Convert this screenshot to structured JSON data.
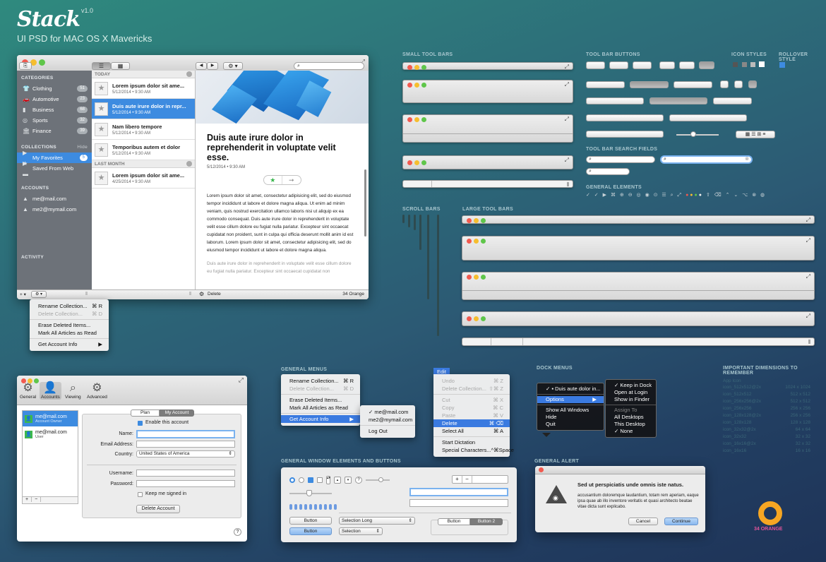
{
  "header": {
    "brand": "Stack",
    "version": "v1.0",
    "subtitle": "UI PSD for MAC OS X Mavericks"
  },
  "main_window": {
    "sidebar": {
      "categories_header": "CATEGORIES",
      "categories": [
        {
          "label": "Clothing",
          "count": "51",
          "icon": "shirt-icon"
        },
        {
          "label": "Automotive",
          "count": "23",
          "icon": "car-icon"
        },
        {
          "label": "Business",
          "count": "68",
          "icon": "chart-icon"
        },
        {
          "label": "Sports",
          "count": "32",
          "icon": "ball-icon"
        },
        {
          "label": "Finance",
          "count": "39",
          "icon": "bank-icon"
        }
      ],
      "collections_header": "COLLECTIONS",
      "collections_hide": "Hide",
      "collections": [
        {
          "label": "My Favorites",
          "count": "5"
        },
        {
          "label": "Saved From Web",
          "count": ""
        }
      ],
      "accounts_header": "ACCOUNTS",
      "accounts": [
        "me@mail.com",
        "me2@mymail.com"
      ],
      "activity_header": "ACTIVITY"
    },
    "list": {
      "today_header": "TODAY",
      "today": [
        {
          "title": "Lorem ipsum dolor sit ame...",
          "date": "5/12/2014  •  9:30 AM",
          "selected": false
        },
        {
          "title": "Duis aute irure dolor in repr...",
          "date": "5/12/2014  •  9:30 AM",
          "selected": true
        },
        {
          "title": "Nam libero tempore",
          "date": "5/12/2014  •  9:30 AM",
          "selected": false
        },
        {
          "title": "Temporibus autem et dolor",
          "date": "5/12/2014  •  9:30 AM",
          "selected": false
        }
      ],
      "last_month_header": "LAST MONTH",
      "last_month": [
        {
          "title": "Lorem ipsum dolor sit ame...",
          "date": "4/25/2014  •  9:30 AM",
          "selected": false
        }
      ]
    },
    "article": {
      "title": "Duis aute irure dolor in reprehenderit in voluptate velit esse.",
      "date": "5/12/2014  •  9:30 AM",
      "body": "Lorem ipsum dolor sit amet, consectetur adipisicing elit, sed do eiusmod tempor incididunt ut labore et dolore magna aliqua. Ut enim ad minim veniam, quis nostrud exercitation ullamco laboris nisi ut aliquip ex ea commodo consequat. Duis aute irure dolor in reprehenderit in voluptate velit esse cillum dolore eu fugiat nulla pariatur. Excepteur sint occaecat cupidatat non proident, sunt in culpa qui officia deserunt mollit anim id est laborum. Lorem ipsum dolor sit amet, consectetur adipisicing elit, sed do eiusmod tempor incididunt ut labore et dolore magna aliqua.",
      "body2": "Duis aute irure dolor in reprehenderit in voluptate velit esse cillum dolore eu fugiat nulla pariatur. Excepteur sint occaecat cupidatat non"
    },
    "bottom_bar": {
      "add": "+ ▾",
      "gear": "⚙ ▾",
      "delete": "Delete",
      "status": "34 Orange"
    }
  },
  "context_menu": [
    {
      "label": "Rename Collection...",
      "shortcut": "⌘ R",
      "disabled": false
    },
    {
      "label": "Delete Collection...",
      "shortcut": "⌘ D",
      "disabled": true
    },
    {
      "sep": true
    },
    {
      "label": "Erase Deleted Items...",
      "shortcut": "",
      "disabled": false
    },
    {
      "label": "Mark All Articles as Read",
      "shortcut": "",
      "disabled": false
    },
    {
      "sep": true
    },
    {
      "label": "Get Account Info",
      "shortcut": "▶",
      "disabled": false
    }
  ],
  "sections": {
    "small_tool_bars": "SMALL TOOL BARS",
    "tool_bar_buttons": "TOOL BAR BUTTONS",
    "icon_styles": "ICON STYLES",
    "rollover_style": "ROLLOVER STYLE",
    "tool_bar_search_fields": "TOOL BAR SEARCH FIELDS",
    "general_elements": "GENERAL ELEMENTS",
    "scroll_bars": "SCROLL BARS",
    "large_tool_bars": "LARGE TOOL BARS",
    "general_menus": "GENERAL MENUS",
    "dock_menus": "DOCK MENUS",
    "important_dimensions": "IMPORTANT DIMENSIONS TO REMEMBER",
    "general_window": "GENERAL WINDOW ELEMENTS AND BUTTONS",
    "general_alert": "GENERAL ALERT"
  },
  "general_menu": [
    {
      "label": "Rename Collection...",
      "shortcut": "⌘ R",
      "disabled": false
    },
    {
      "label": "Delete Collection...",
      "shortcut": "⌘ D",
      "disabled": true
    },
    {
      "sep": true
    },
    {
      "label": "Erase Deleted Items...",
      "shortcut": "",
      "disabled": false
    },
    {
      "label": "Mark All Articles as Read",
      "shortcut": "",
      "disabled": false
    },
    {
      "sep": true
    },
    {
      "label": "Get Account Info",
      "shortcut": "▶",
      "disabled": false,
      "selected": true
    }
  ],
  "submenu": [
    {
      "label": "✓ me@mail.com"
    },
    {
      "label": "me2@mymail.com"
    },
    {
      "sep": true
    },
    {
      "label": "Log Out"
    }
  ],
  "edit_menu": {
    "title": "Edit",
    "items": [
      {
        "label": "Undo",
        "shortcut": "⌘ Z",
        "disabled": true
      },
      {
        "label": "Delete Collection...",
        "shortcut": "⇧⌘ Z",
        "disabled": true
      },
      {
        "sep": true
      },
      {
        "label": "Cut",
        "shortcut": "⌘ X",
        "disabled": true
      },
      {
        "label": "Copy",
        "shortcut": "⌘ C",
        "disabled": true
      },
      {
        "label": "Paste",
        "shortcut": "⌘ V",
        "disabled": true
      },
      {
        "label": "Delete",
        "shortcut": "⌘ ⌫",
        "disabled": false,
        "selected": true
      },
      {
        "label": "Select All",
        "shortcut": "⌘ A",
        "disabled": false
      },
      {
        "sep": true
      },
      {
        "label": "Start Dictation",
        "shortcut": "",
        "disabled": false
      },
      {
        "label": "Special Characters...",
        "shortcut": "^⌘Space",
        "disabled": false
      }
    ]
  },
  "dock_menu": {
    "items": [
      {
        "label": "✓ ▪ Duis aute dolor in...",
        "selected": false
      },
      {
        "sep": true
      },
      {
        "label": "Options",
        "shortcut": "▶",
        "selected": true
      },
      {
        "sep": true
      },
      {
        "label": "Show All Windows",
        "selected": false
      },
      {
        "label": "Hide",
        "selected": false
      },
      {
        "label": "Quit",
        "selected": false
      }
    ],
    "submenu": [
      {
        "label": "✓ Keep in Dock",
        "disabled": false
      },
      {
        "label": "Open at Login",
        "disabled": false
      },
      {
        "label": "Show in Finder",
        "disabled": false
      },
      {
        "sep": true
      },
      {
        "label": "Assign To",
        "disabled": true
      },
      {
        "label": "All Desktops",
        "disabled": false
      },
      {
        "label": "This Desktop",
        "disabled": false
      },
      {
        "label": "✓ None",
        "disabled": false
      }
    ]
  },
  "dimensions": {
    "header": "App Icon",
    "rows": [
      {
        "name": "icon_512x512@2x",
        "value": "1024 x 1024"
      },
      {
        "name": "icon_512x512",
        "value": "512 x 512"
      },
      {
        "name": "icon_256x256@2x",
        "value": "512 x 512"
      },
      {
        "name": "icon_256x256",
        "value": "256 x 256"
      },
      {
        "name": "icon_128x128@2x",
        "value": "256 x 256"
      },
      {
        "name": "icon_128x128",
        "value": "128 x 128"
      },
      {
        "name": "icon_32x32@2x",
        "value": "64 x 64"
      },
      {
        "name": "icon_32x32",
        "value": "32 x 32"
      },
      {
        "name": "icon_16x16@2x",
        "value": "32 x 32"
      },
      {
        "name": "icon_16x16",
        "value": "16 x 16"
      }
    ]
  },
  "prefs": {
    "tabs": [
      "General",
      "Accounts",
      "Viewing",
      "Advanced"
    ],
    "accounts": [
      {
        "email": "me@mail.com",
        "role": "Account Owner",
        "selected": true
      },
      {
        "email": "me@mail.com",
        "role": "User",
        "selected": false
      }
    ],
    "segments": [
      "Plan",
      "My Account"
    ],
    "enable_label": "Enable this account",
    "name_label": "Name:",
    "email_label": "Email Address:",
    "country_label": "Country:",
    "country_value": "United States of America",
    "username_label": "Username:",
    "password_label": "Password:",
    "keep_signed": "Keep me signed in",
    "delete_btn": "Delete Account",
    "help": "?"
  },
  "gen_window": {
    "button": "Button",
    "selection_long": "Selection Long",
    "selection": "Selection",
    "seg_left": "Button",
    "seg_right": "Button 2",
    "plus": "+",
    "minus": "−"
  },
  "alert": {
    "title": "Sed ut perspiciatis unde omnis iste natus.",
    "body": "accusantium doloremque laudantium, totam rem aperiam, eaque ipsa quae ab illo inventore veritatis et quasi architecto beatae vitae dicta sunt explicabo.",
    "cancel": "Cancel",
    "continue": "Continue"
  },
  "badge": {
    "label": "34 ORANGE"
  },
  "colors": {
    "accent": "#3d8be0",
    "orange": "#f6a623",
    "badge_text": "#e0549a"
  }
}
